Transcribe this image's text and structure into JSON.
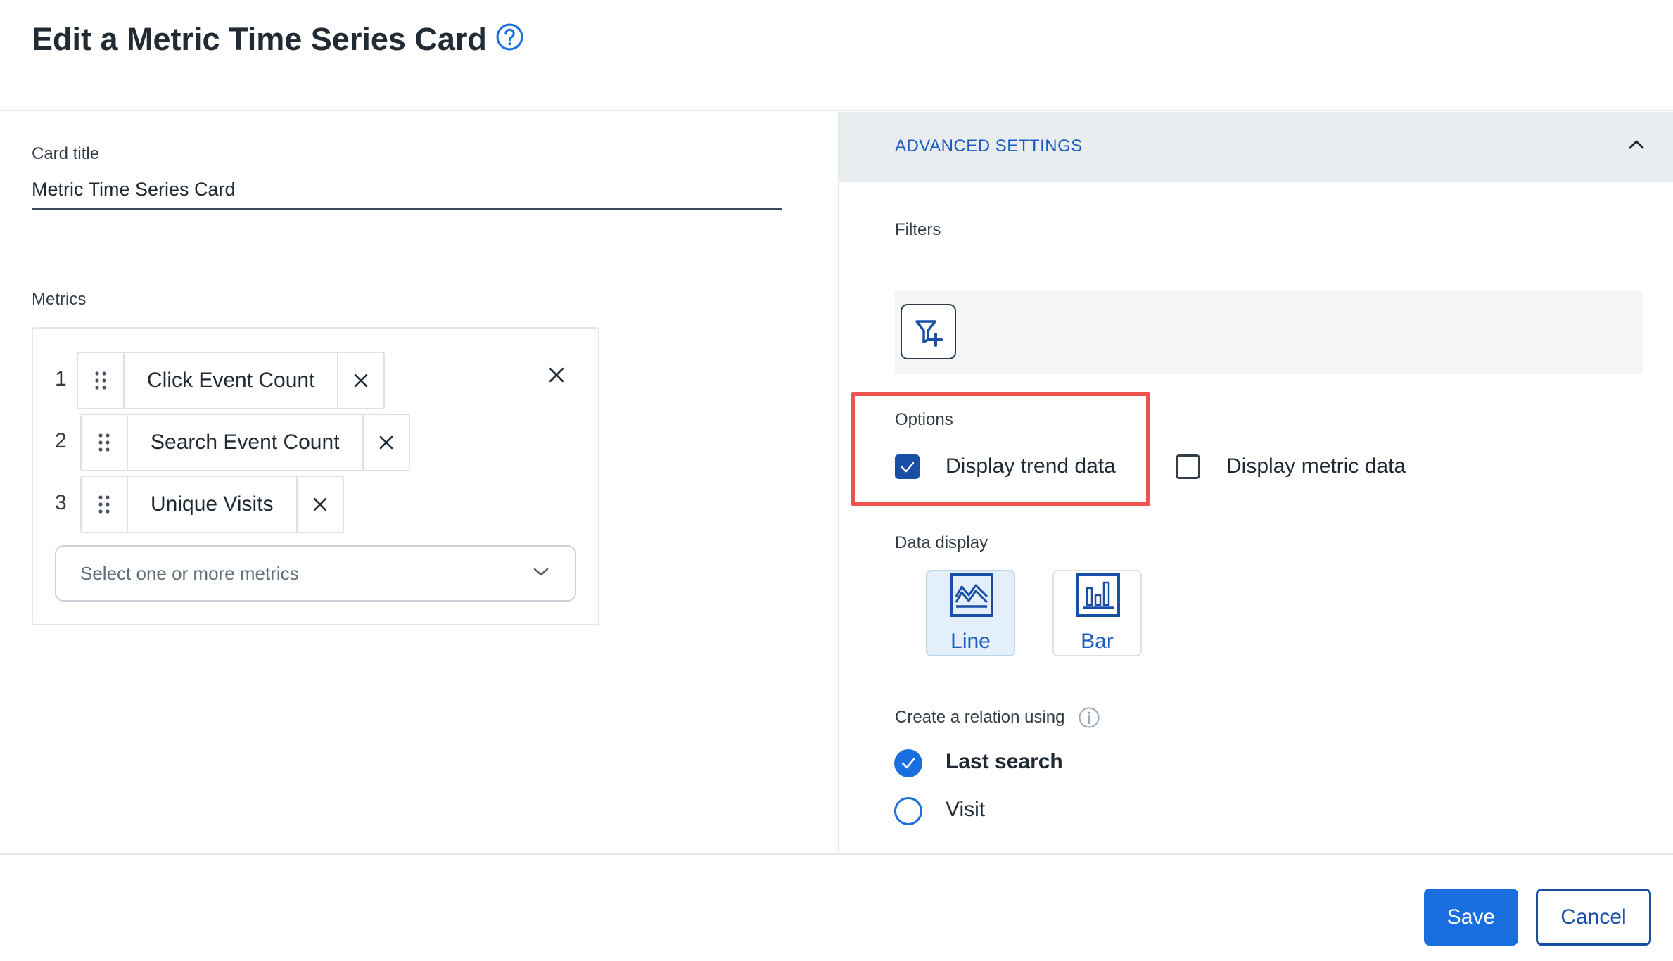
{
  "page": {
    "title": "Edit a Metric Time Series Card",
    "help_icon": "question-circle-icon"
  },
  "card_title": {
    "label": "Card title",
    "value": "Metric Time Series Card"
  },
  "metrics": {
    "label": "Metrics",
    "items": [
      {
        "index": "1",
        "label": "Click Event Count"
      },
      {
        "index": "2",
        "label": "Search Event Count"
      },
      {
        "index": "3",
        "label": "Unique Visits"
      }
    ],
    "select_placeholder": "Select one or more metrics"
  },
  "advanced": {
    "title": "ADVANCED SETTINGS",
    "expanded": true,
    "filters_label": "Filters",
    "add_filter_icon": "filter-plus-icon",
    "options": {
      "label": "Options",
      "items": [
        {
          "label": "Display trend data",
          "checked": true
        },
        {
          "label": "Display metric data",
          "checked": false
        }
      ]
    },
    "data_display": {
      "label": "Data display",
      "items": [
        {
          "label": "Line",
          "icon": "line-chart-icon",
          "selected": true
        },
        {
          "label": "Bar",
          "icon": "bar-chart-icon",
          "selected": false
        }
      ]
    },
    "relation": {
      "label": "Create a relation using",
      "options": [
        {
          "label": "Last search",
          "checked": true
        },
        {
          "label": "Visit",
          "checked": false
        }
      ]
    }
  },
  "footer": {
    "save_label": "Save",
    "cancel_label": "Cancel"
  },
  "colors": {
    "primary": "#1a6fe0",
    "primary_dark": "#1a4fa8",
    "highlight": "#ef5350",
    "advanced_header_bg": "#eaedf0"
  }
}
